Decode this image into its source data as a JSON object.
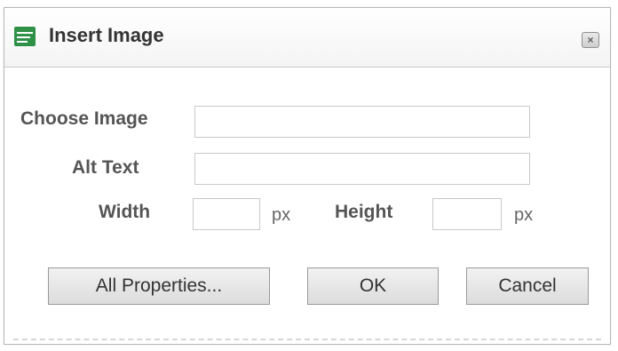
{
  "dialog": {
    "title": "Insert Image",
    "close_icon_name": "close-icon"
  },
  "form": {
    "choose_image_label": "Choose Image",
    "choose_image_value": "",
    "alt_text_label": "Alt Text",
    "alt_text_value": "",
    "width_label": "Width",
    "width_value": "",
    "width_unit": "px",
    "height_label": "Height",
    "height_value": "",
    "height_unit": "px"
  },
  "buttons": {
    "all_properties": "All Properties...",
    "ok": "OK",
    "cancel": "Cancel"
  },
  "colors": {
    "dialog_border": "#b7b7b7",
    "label_text": "#555555",
    "button_text": "#333333",
    "icon_green": "#2f9148"
  }
}
